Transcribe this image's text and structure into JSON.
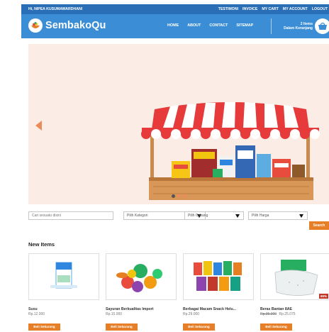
{
  "topbar": {
    "greeting": "Hi, NIPEA KUSUMAWARDHANI",
    "links": [
      "TESTIMONI",
      "INVOICE",
      "MY CART",
      "MY ACCOUNT",
      "LOGOUT"
    ]
  },
  "header": {
    "brand": "SembakoQu",
    "nav": [
      "HOME",
      "ABOUT",
      "CONTACT",
      "SITEMAP"
    ],
    "cart_count": "2 Items",
    "cart_label": "Dalam Keranjang"
  },
  "hero": {
    "slide_count": 3,
    "active_slide": 1
  },
  "filters": {
    "search_placeholder": "Cari sesuatu disini",
    "kategori": "Pilih Kategori",
    "cabang": "Pilih Cabang",
    "harga": "Pilih Harga",
    "search_button": "Search"
  },
  "new_items": {
    "title": "New Items",
    "buy_label": "Beli Sekarang",
    "products": [
      {
        "name": "Susu",
        "price": "Rp.12.000",
        "old_price": "",
        "badge": ""
      },
      {
        "name": "Sayuran Berkualitas Import",
        "price": "Rp.15.000",
        "old_price": "",
        "badge": ""
      },
      {
        "name": "Berbagai Macam Snack Helu...",
        "price": "Rp.29.000",
        "old_price": "",
        "badge": ""
      },
      {
        "name": "Beras Bantan 8AE",
        "price": "Rp.25.075",
        "old_price": "Rp.35.000",
        "badge": "65%"
      }
    ]
  },
  "colors": {
    "topbar": "#2a6fb6",
    "header": "#3b8ed6",
    "accent": "#e67f27",
    "hero_bg": "#fbece6"
  }
}
